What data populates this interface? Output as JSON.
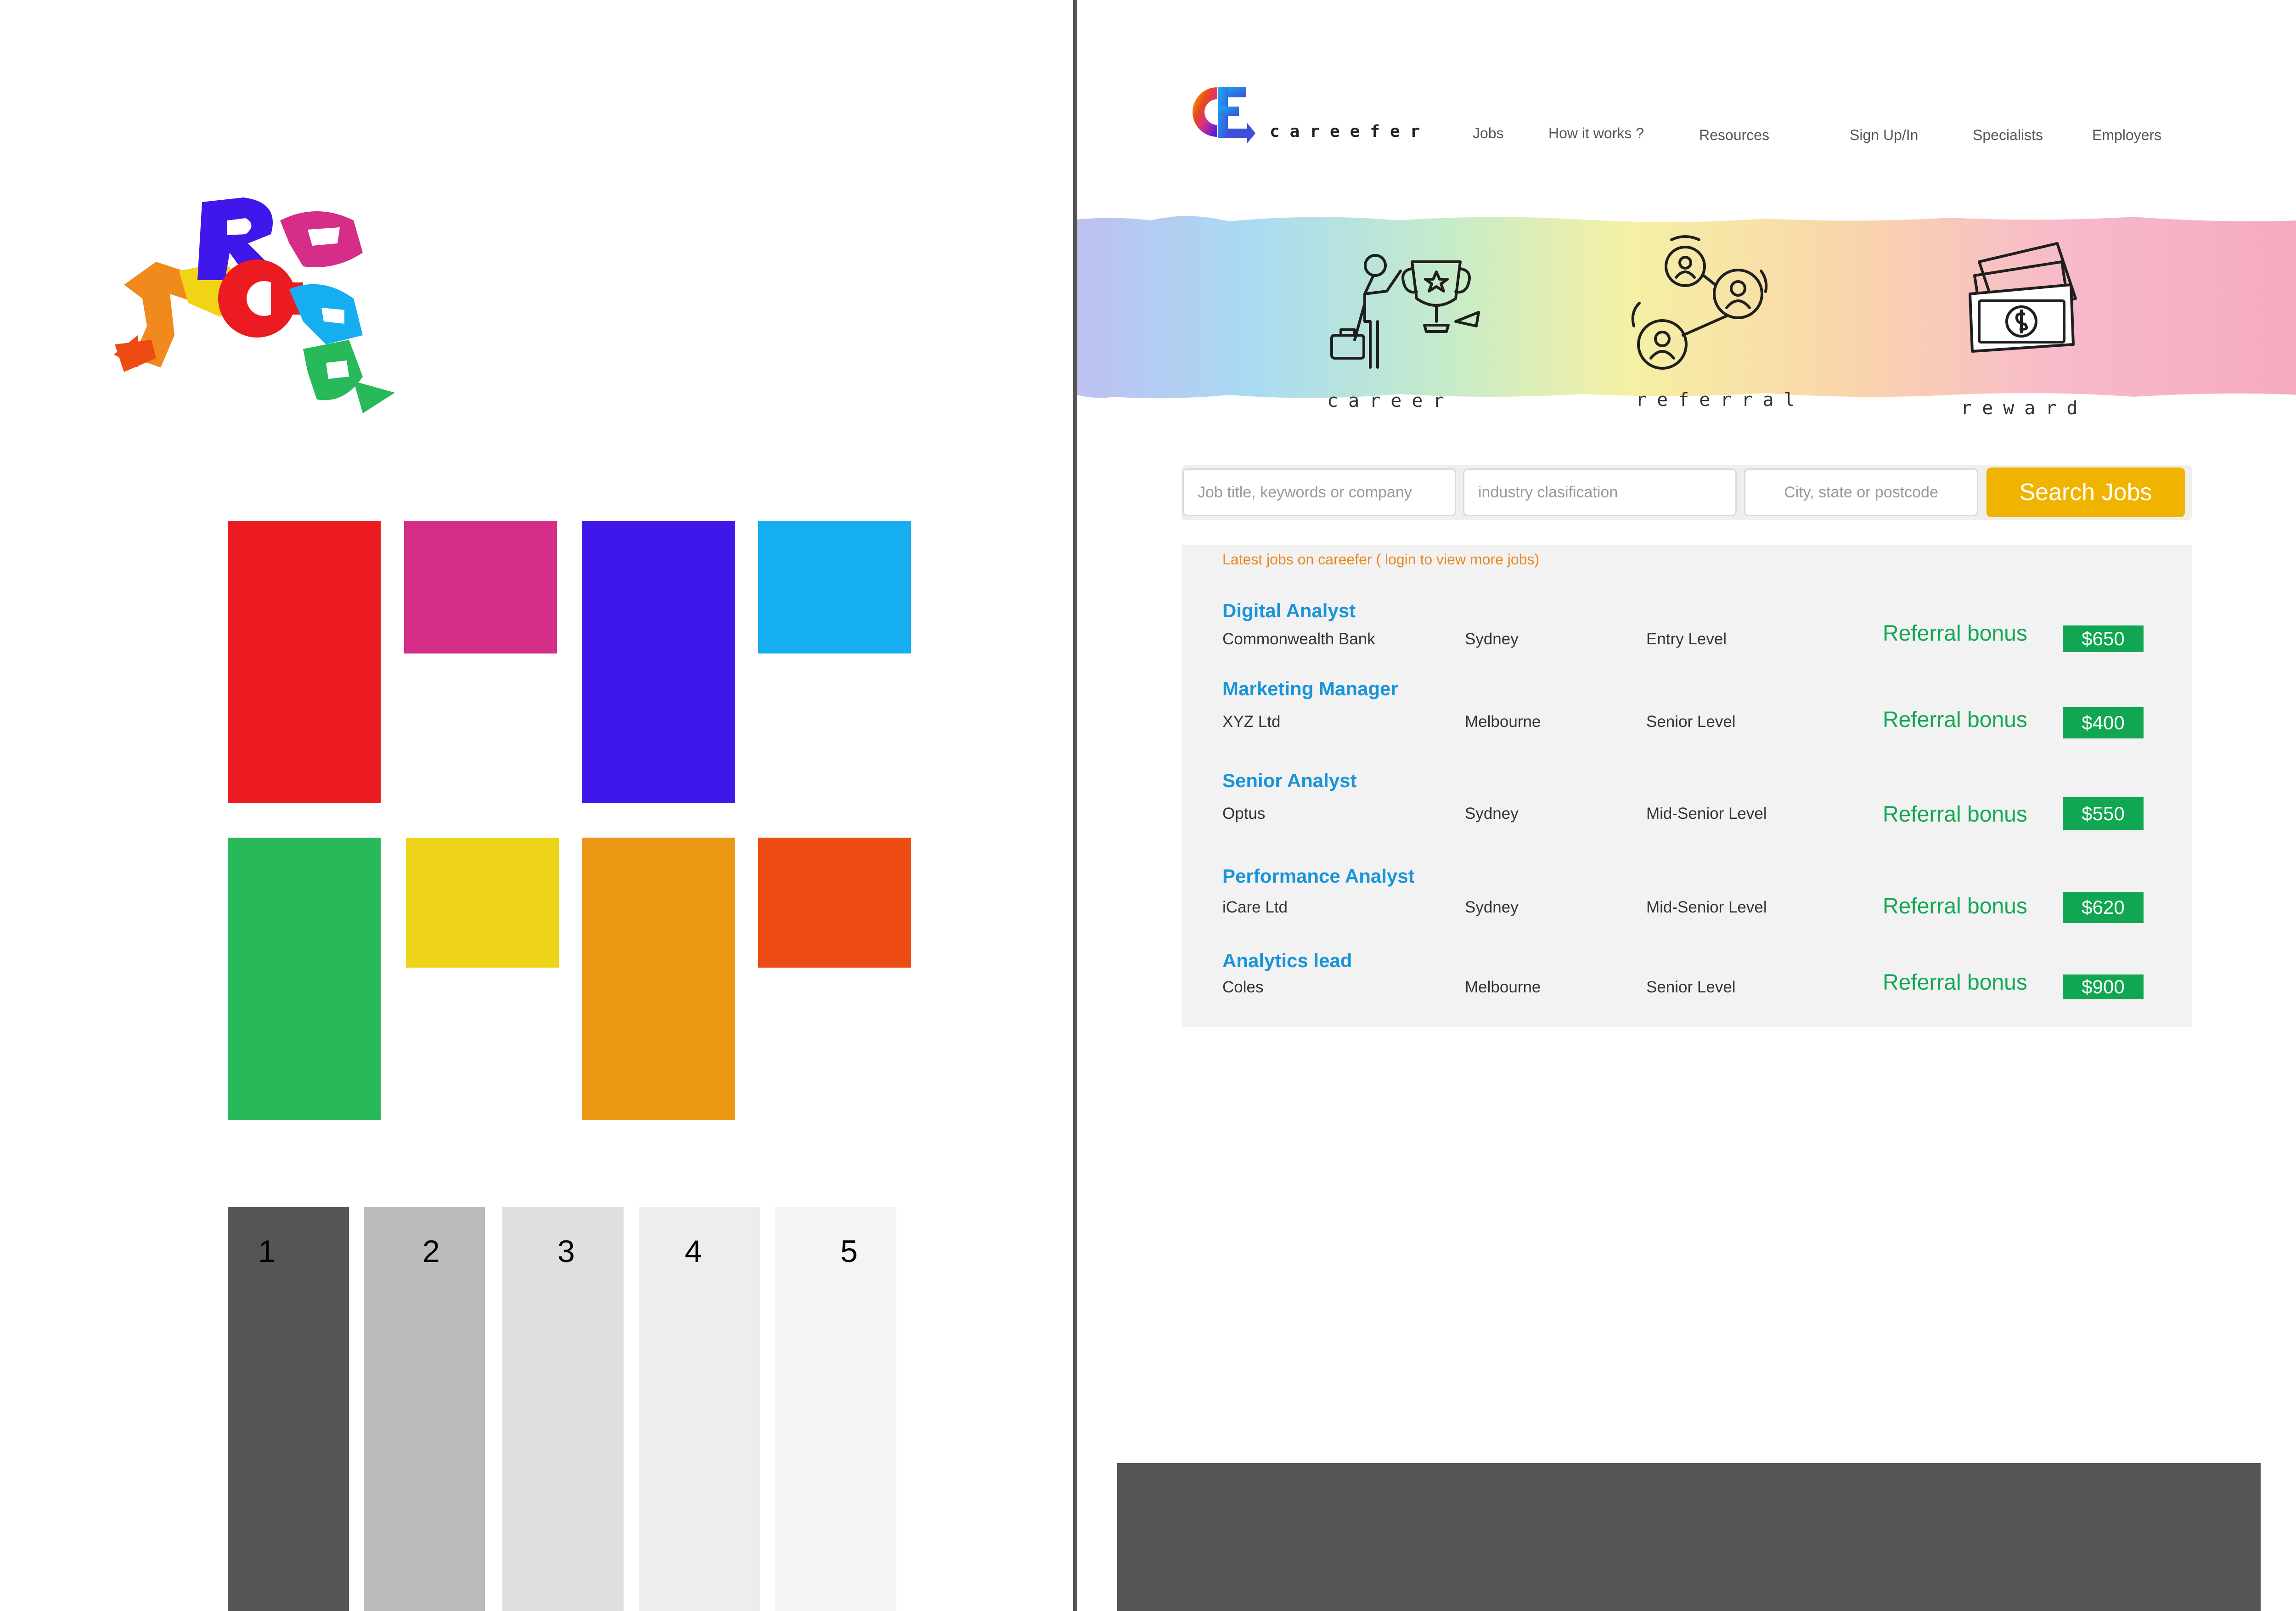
{
  "style_guide": {
    "brand_colors": [
      {
        "name": "red",
        "hex": "#ec1b22"
      },
      {
        "name": "magenta",
        "hex": "#d52d88"
      },
      {
        "name": "violet",
        "hex": "#3f17ea"
      },
      {
        "name": "sky-blue",
        "hex": "#15aef0"
      },
      {
        "name": "green",
        "hex": "#27b95a"
      },
      {
        "name": "yellow",
        "hex": "#edd418"
      },
      {
        "name": "orange",
        "hex": "#ec9714"
      },
      {
        "name": "orange-red",
        "hex": "#ed4b14"
      }
    ],
    "grays": [
      {
        "label": "1",
        "hex": "#545557"
      },
      {
        "label": "2",
        "hex": "#bcbbbc"
      },
      {
        "label": "3",
        "hex": "#e0dfe0"
      },
      {
        "label": "4",
        "hex": "#eeedee"
      },
      {
        "label": "5",
        "hex": "#f4f4f4"
      }
    ]
  },
  "site": {
    "brand_name": "careefer",
    "nav": [
      "Jobs",
      "How it works ?",
      "Resources",
      "Sign Up/In",
      "Specialists",
      "Employers"
    ],
    "banner": {
      "items": [
        {
          "label": "career",
          "icon": "trophy-person-icon"
        },
        {
          "label": "referral",
          "icon": "network-people-icon"
        },
        {
          "label": "reward",
          "icon": "money-stack-icon"
        }
      ]
    },
    "search": {
      "keyword_placeholder": "Job title, keywords or company",
      "industry_placeholder": "industry clasification",
      "location_placeholder": "City, state or postcode",
      "button_label": "Search Jobs"
    },
    "jobs": {
      "heading": "Latest jobs on careefer  ( login to view more jobs)",
      "bonus_label": "Referral bonus",
      "items": [
        {
          "title": "Digital Analyst",
          "company": "Commonwealth Bank",
          "location": "Sydney",
          "level": "Entry Level",
          "bonus": "$650"
        },
        {
          "title": "Marketing Manager",
          "company": "XYZ Ltd",
          "location": "Melbourne",
          "level": "Senior Level",
          "bonus": "$400"
        },
        {
          "title": "Senior Analyst",
          "company": "Optus",
          "location": "Sydney",
          "level": "Mid-Senior Level",
          "bonus": "$550"
        },
        {
          "title": "Performance Analyst",
          "company": "iCare Ltd",
          "location": "Sydney",
          "level": "Mid-Senior Level",
          "bonus": "$620"
        },
        {
          "title": "Analytics lead",
          "company": "Coles",
          "location": "Melbourne",
          "level": "Senior Level",
          "bonus": "$900"
        }
      ]
    }
  }
}
